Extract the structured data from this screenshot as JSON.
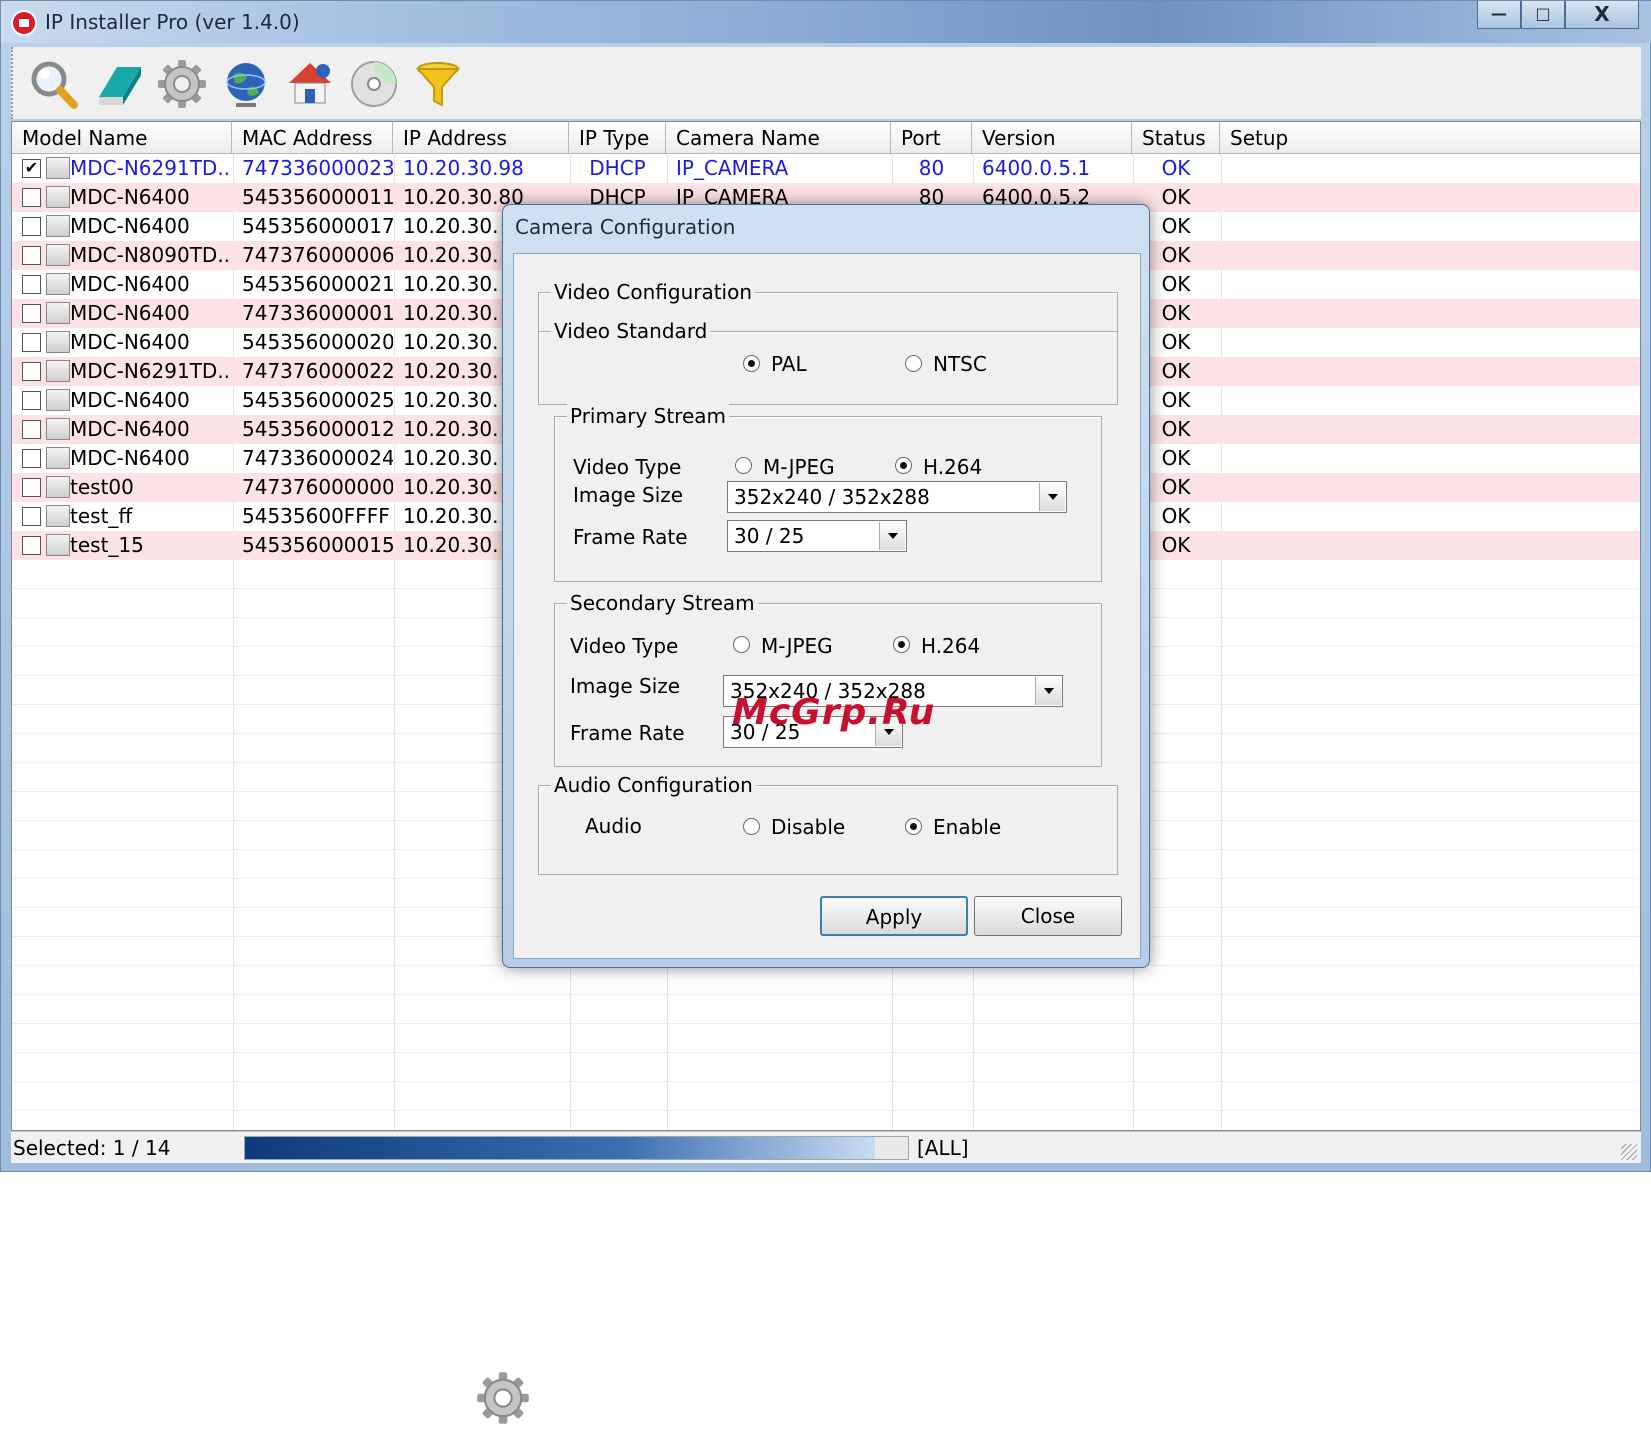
{
  "window": {
    "title": "IP Installer Pro (ver 1.4.0)",
    "controls": {
      "minimize": "—",
      "maximize": "□",
      "close": "X"
    }
  },
  "toolbar": {
    "icons": [
      "search-icon",
      "eraser-icon",
      "gear-icon",
      "globe-icon",
      "home-network-icon",
      "disc-icon",
      "filter-funnel-icon"
    ]
  },
  "table": {
    "columns": [
      "Model Name",
      "MAC Address",
      "IP Address",
      "IP Type",
      "Camera Name",
      "Port",
      "Version",
      "Status",
      "Setup"
    ],
    "rows": [
      {
        "checked": true,
        "model": "MDC-N6291TD...",
        "mac": "747336000023",
        "ip": "10.20.30.98",
        "iptype": "DHCP",
        "name": "IP_CAMERA",
        "port": "80",
        "version": "6400.0.5.1",
        "status": "OK"
      },
      {
        "checked": false,
        "model": "MDC-N6400",
        "mac": "545356000011",
        "ip": "10.20.30.80",
        "iptype": "DHCP",
        "name": "IP_CAMERA",
        "port": "80",
        "version": "6400.0.5.2",
        "status": "OK"
      },
      {
        "checked": false,
        "model": "MDC-N6400",
        "mac": "545356000017",
        "ip": "10.20.30.",
        "iptype": "",
        "name": "",
        "port": "",
        "version": "",
        "status": "OK"
      },
      {
        "checked": false,
        "model": "MDC-N8090TD...",
        "mac": "747376000006",
        "ip": "10.20.30.",
        "iptype": "",
        "name": "",
        "port": "",
        "version": "",
        "status": "OK"
      },
      {
        "checked": false,
        "model": "MDC-N6400",
        "mac": "545356000021",
        "ip": "10.20.30.",
        "iptype": "",
        "name": "",
        "port": "",
        "version": "",
        "status": "OK"
      },
      {
        "checked": false,
        "model": "MDC-N6400",
        "mac": "747336000001",
        "ip": "10.20.30.",
        "iptype": "",
        "name": "",
        "port": "",
        "version": "",
        "status": "OK"
      },
      {
        "checked": false,
        "model": "MDC-N6400",
        "mac": "545356000020",
        "ip": "10.20.30.",
        "iptype": "",
        "name": "",
        "port": "",
        "version": "",
        "status": "OK"
      },
      {
        "checked": false,
        "model": "MDC-N6291TD...",
        "mac": "747376000022",
        "ip": "10.20.30.",
        "iptype": "",
        "name": "",
        "port": "",
        "version": "",
        "status": "OK"
      },
      {
        "checked": false,
        "model": "MDC-N6400",
        "mac": "545356000025",
        "ip": "10.20.30.",
        "iptype": "",
        "name": "",
        "port": "",
        "version": "",
        "status": "OK"
      },
      {
        "checked": false,
        "model": "MDC-N6400",
        "mac": "545356000012",
        "ip": "10.20.30.",
        "iptype": "",
        "name": "",
        "port": "",
        "version": "",
        "status": "OK"
      },
      {
        "checked": false,
        "model": "MDC-N6400",
        "mac": "747336000024",
        "ip": "10.20.30.",
        "iptype": "",
        "name": "",
        "port": "",
        "version": "",
        "status": "OK"
      },
      {
        "checked": false,
        "model": "test00",
        "mac": "747376000000",
        "ip": "10.20.30.",
        "iptype": "",
        "name": "",
        "port": "",
        "version": "",
        "status": "OK"
      },
      {
        "checked": false,
        "model": "test_ff",
        "mac": "54535600FFFF",
        "ip": "10.20.30.",
        "iptype": "",
        "name": "",
        "port": "",
        "version": "",
        "status": "OK"
      },
      {
        "checked": false,
        "model": "test_15",
        "mac": "545356000015",
        "ip": "10.20.30.",
        "iptype": "",
        "name": "",
        "port": "",
        "version": "",
        "status": "OK"
      }
    ]
  },
  "statusbar": {
    "selected": "Selected: 1 / 14",
    "progress_fraction": 0.95,
    "filter": "[ALL]"
  },
  "dialog": {
    "title": "Camera Configuration",
    "video_config_legend": "Video Configuration",
    "video_standard_legend": "Video Standard",
    "standard_options": [
      "PAL",
      "NTSC"
    ],
    "standard_selected": "PAL",
    "primary": {
      "legend": "Primary Stream",
      "video_type_label": "Video Type",
      "type_options": [
        "M-JPEG",
        "H.264"
      ],
      "type_selected": "H.264",
      "image_size_label": "Image Size",
      "image_size_value": "352x240 / 352x288",
      "frame_rate_label": "Frame Rate",
      "frame_rate_value": "30 / 25"
    },
    "secondary": {
      "legend": "Secondary Stream",
      "video_type_label": "Video Type",
      "type_options": [
        "M-JPEG",
        "H.264"
      ],
      "type_selected": "H.264",
      "image_size_label": "Image Size",
      "image_size_value": "352x240 / 352x288",
      "frame_rate_label": "Frame Rate",
      "frame_rate_value": "30 / 25"
    },
    "audio": {
      "legend": "Audio Configuration",
      "label": "Audio",
      "options": [
        "Disable",
        "Enable"
      ],
      "selected": "Enable"
    },
    "apply_label": "Apply",
    "close_label": "Close"
  },
  "watermark": "McGrp.Ru",
  "colors": {
    "selected_row_text": "#1a1ae6",
    "alt_row_bg": "#fde3e5",
    "title_gradient": "#8eaed6"
  }
}
